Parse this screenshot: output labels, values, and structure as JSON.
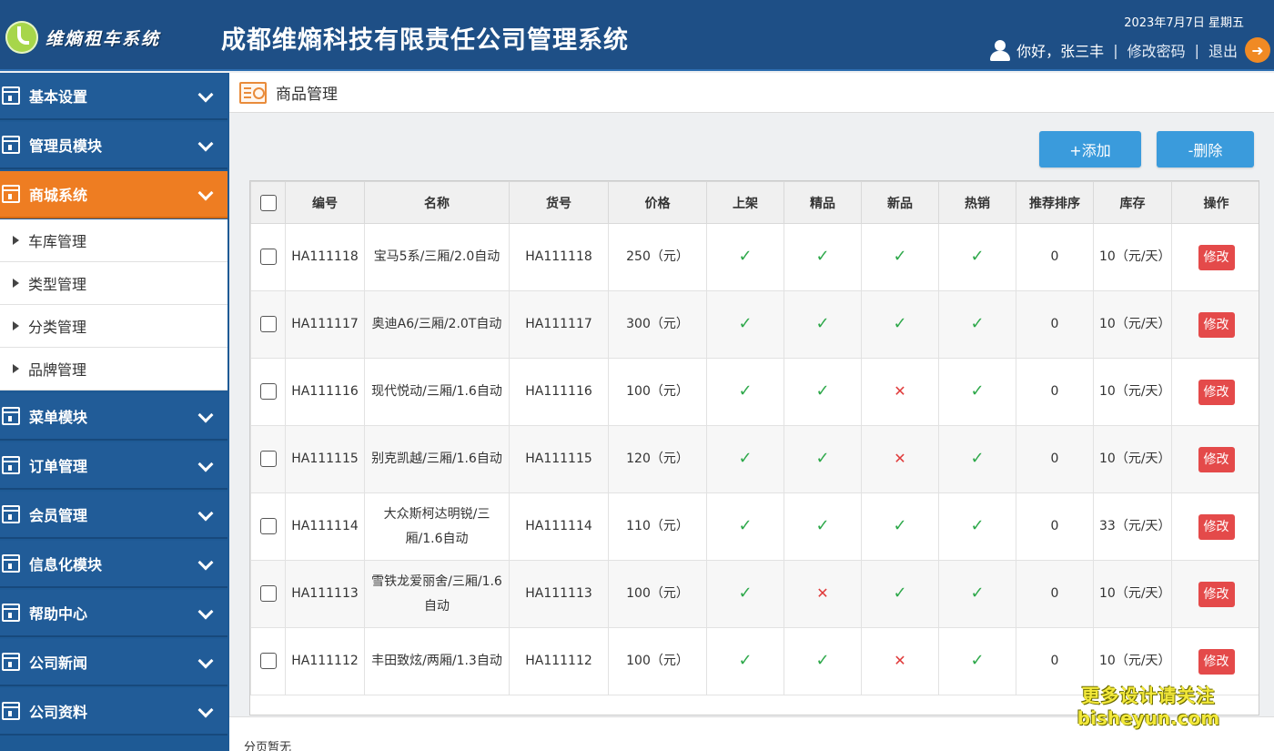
{
  "header": {
    "logo_text": "维熵租车系统",
    "app_title": "成都维熵科技有限责任公司管理系统",
    "date": "2023年7月7日 星期五",
    "greeting": "你好，张三丰",
    "sep": "|",
    "change_password": "修改密码",
    "logout": "退出"
  },
  "sidebar": {
    "groups": [
      {
        "label": "基本设置"
      },
      {
        "label": "管理员模块"
      },
      {
        "label": "商城系统"
      },
      {
        "label": "菜单模块"
      },
      {
        "label": "订单管理"
      },
      {
        "label": "会员管理"
      },
      {
        "label": "信息化模块"
      },
      {
        "label": "帮助中心"
      },
      {
        "label": "公司新闻"
      },
      {
        "label": "公司资料"
      }
    ],
    "sub_items": [
      {
        "label": "车库管理"
      },
      {
        "label": "类型管理"
      },
      {
        "label": "分类管理"
      },
      {
        "label": "品牌管理"
      }
    ]
  },
  "page": {
    "title": "商品管理",
    "add_label": "+添加",
    "delete_label": "-删除",
    "footer": "分页暂无"
  },
  "table": {
    "headers": [
      "编号",
      "名称",
      "货号",
      "价格",
      "上架",
      "精品",
      "新品",
      "热销",
      "推荐排序",
      "库存",
      "操作"
    ],
    "edit_label": "修改",
    "rows": [
      {
        "id": "HA111118",
        "name": "宝马5系/三厢/2.0自动",
        "sku": "HA111118",
        "price": "250（元）",
        "onsale": true,
        "premium": true,
        "isnew": true,
        "hot": true,
        "rank": "0",
        "stock": "10（元/天）"
      },
      {
        "id": "HA111117",
        "name": "奥迪A6/三厢/2.0T自动",
        "sku": "HA111117",
        "price": "300（元）",
        "onsale": true,
        "premium": true,
        "isnew": true,
        "hot": true,
        "rank": "0",
        "stock": "10（元/天）"
      },
      {
        "id": "HA111116",
        "name": "现代悦动/三厢/1.6自动",
        "sku": "HA111116",
        "price": "100（元）",
        "onsale": true,
        "premium": true,
        "isnew": false,
        "hot": true,
        "rank": "0",
        "stock": "10（元/天）"
      },
      {
        "id": "HA111115",
        "name": "别克凯越/三厢/1.6自动",
        "sku": "HA111115",
        "price": "120（元）",
        "onsale": true,
        "premium": true,
        "isnew": false,
        "hot": true,
        "rank": "0",
        "stock": "10（元/天）"
      },
      {
        "id": "HA111114",
        "name": "大众斯柯达明锐/三厢/1.6自动",
        "sku": "HA111114",
        "price": "110（元）",
        "onsale": true,
        "premium": true,
        "isnew": true,
        "hot": true,
        "rank": "0",
        "stock": "33（元/天）"
      },
      {
        "id": "HA111113",
        "name": "雪铁龙爱丽舍/三厢/1.6自动",
        "sku": "HA111113",
        "price": "100（元）",
        "onsale": true,
        "premium": false,
        "isnew": true,
        "hot": true,
        "rank": "0",
        "stock": "10（元/天）"
      },
      {
        "id": "HA111112",
        "name": "丰田致炫/两厢/1.3自动",
        "sku": "HA111112",
        "price": "100（元）",
        "onsale": true,
        "premium": true,
        "isnew": false,
        "hot": true,
        "rank": "0",
        "stock": "10（元/天）"
      }
    ]
  },
  "marks": {
    "check": "✓",
    "cross": "✕"
  },
  "watermark": {
    "line1": "更多设计请关注",
    "line2": "bisheyun.com"
  },
  "colors": {
    "header_bg": "#1e4f86",
    "sidebar_bg": "#215c98",
    "active_bg": "#ee7d22",
    "button_bg": "#3a9bdc",
    "edit_bg": "#e44a4a",
    "check": "#2da84a",
    "cross": "#e03b3b"
  }
}
